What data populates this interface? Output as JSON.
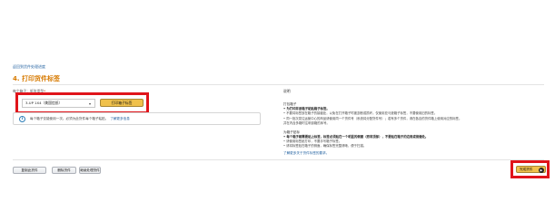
{
  "breadcrumb": {
    "back_link": "返回到货件处理进度"
  },
  "section": {
    "title": "4. 打印货件标签"
  },
  "form": {
    "label": "每个箱子：纸张类型",
    "required_mark": "*",
    "select_value": "3-UP 1X4（美国信纸）",
    "print_button": "打印箱子标签"
  },
  "info": {
    "text": "每个箱子仅能使用一次。必须为此货件每个箱子粘贴。",
    "link": "了解更多信息"
  },
  "help": {
    "heading": "说明",
    "group1_title": "打包箱子",
    "group1_lines": [
      "• 为打印并逐箱子粘贴箱子标签。",
      "• 不要将标签放在箱子的接缝处，以免在打开箱子时被割断或损坏。仅使用亚马逊箱子标签，不要使用旧的标签。",
      "• 同一批次发往运营中心的商品请使用同一个货件号（系统将分配货件号）；若有多个货件，请在各自的货件箱上使用对应的标签。",
      "  并在内含多箱时注明该箱的序号。"
    ],
    "group2_title": "为箱子贴标",
    "group2_lines": [
      "• 每个箱子都需要贴上标签，标签必须贴在一个明显的侧面（而非顶部），不要贴在箱子的边角或接缝处。",
      "• 请使用标签纸打印，不要手写箱子标签。",
      "• 请将标签贴在箱子的侧面，确保标签完整清晰，便于扫描。"
    ],
    "link": "了解更多关于货件标签的要求。"
  },
  "actions": {
    "copy_button": "复制此货件",
    "delete_button": "删除货件",
    "work_button": "继续处理货件",
    "save_button": "完成货件"
  },
  "colors": {
    "accent_orange": "#d77a00",
    "highlight_red": "#e0141a",
    "button_yellow": "#f0c14b",
    "link_blue": "#1f5f9f"
  }
}
